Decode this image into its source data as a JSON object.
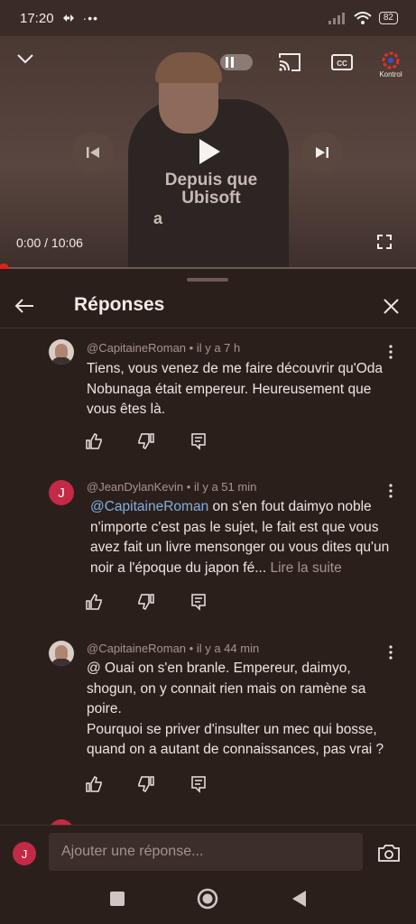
{
  "status_bar": {
    "time": "17:20",
    "battery": "82"
  },
  "video": {
    "overlay_text": "Depuis que Ubisoft",
    "overlay_text_2": "a",
    "time_current": "0:00",
    "time_separator": "/",
    "time_total": "10:06",
    "progress": 0.0,
    "settings_badge": "Kontrol",
    "icons": {
      "collapse": "chevron-down-icon",
      "autoplay": "autoplay-toggle",
      "cast": "cast-icon",
      "captions": "closed-captions-icon",
      "settings": "gear-icon",
      "previous": "skip-previous-icon",
      "play": "play-icon",
      "next": "skip-next-icon",
      "fullscreen": "fullscreen-icon"
    }
  },
  "panel": {
    "title": "Réponses",
    "back_icon": "arrow-left-icon",
    "close_icon": "close-icon"
  },
  "comments": [
    {
      "author": "@CapitaineRoman",
      "age": "il y a 7 h",
      "avatar": "photo",
      "text": "Tiens, vous venez de me faire découvrir qu'Oda Nobunaga était empereur. Heureusement que vous êtes là."
    },
    {
      "author": "@JeanDylanKevin",
      "age": "il y a 51 min",
      "avatar": "J",
      "mention": "@CapitaineRoman",
      "text": " on s'en fout daimyo noble n'importe c'est pas le sujet,  le fait est que vous avez fait un livre mensonger ou vous dites qu'un noir a l'époque du japon fé...",
      "read_more": "Lire la suite"
    },
    {
      "author": "@CapitaineRoman",
      "age": "il y a 44 min",
      "avatar": "photo",
      "text_line1": "@ Ouai on s'en branle. Empereur, daimyo, shogun, on y connait rien mais on ramène sa poire.",
      "text_line2": "Pourquoi se priver d'insulter un mec qui bosse, quand on a autant de connaissances, pas vrai ?"
    }
  ],
  "comment_separator": "•",
  "reply_bar": {
    "avatar_letter": "J",
    "placeholder": "Ajouter une réponse..."
  },
  "nav": {
    "recents": "square-icon",
    "home": "circle-home-icon",
    "back": "triangle-back-icon"
  },
  "colors": {
    "background": "#2b1f1c",
    "mention": "#7fb0de",
    "progress_red": "#e0221a",
    "avatar_red": "#c42a45"
  }
}
